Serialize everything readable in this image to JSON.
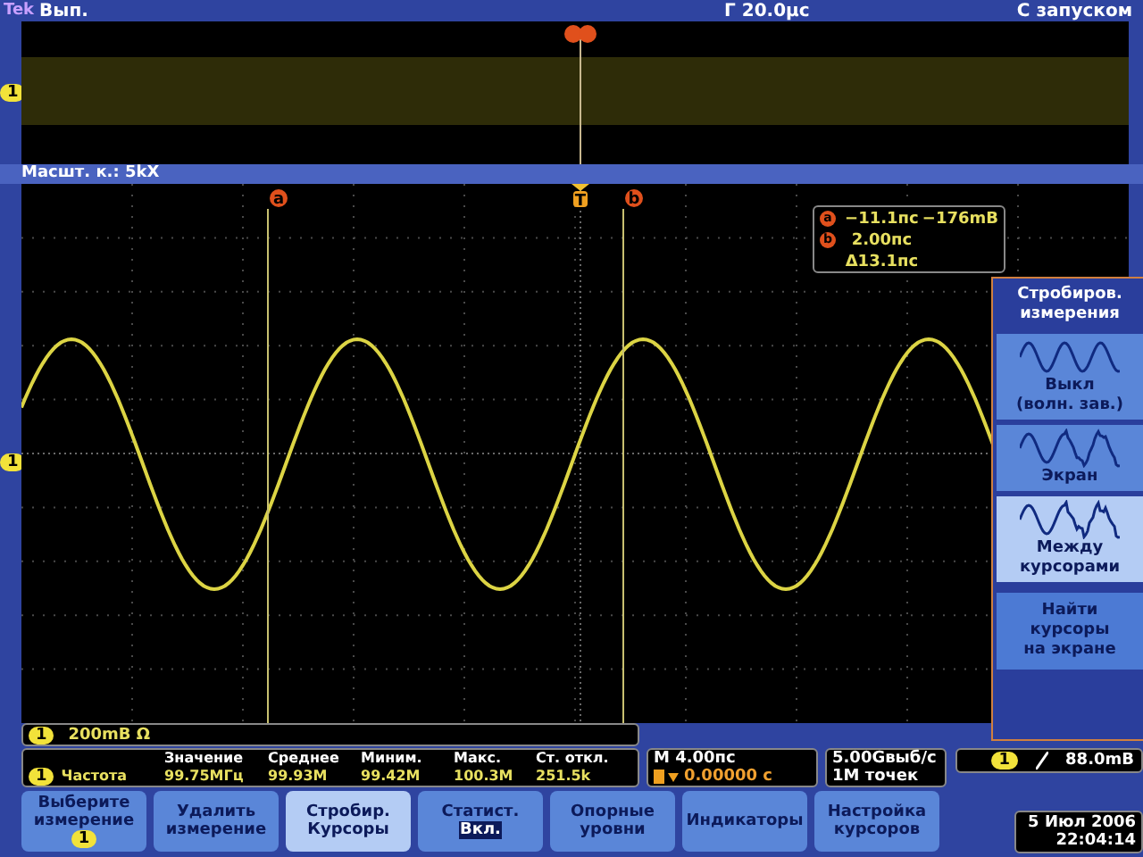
{
  "top_bar": {
    "logo": "Tek",
    "acquisition": "Вып.",
    "horizontal": "Г 20.0μс",
    "trigger_mode": "С запуском"
  },
  "overview": {
    "channel": "1"
  },
  "zoom_label": "Масшт. к.: 5kX",
  "graticule": {
    "channel": "1",
    "trigger_marker": "T",
    "cursors": [
      {
        "label": "a"
      },
      {
        "label": "b"
      }
    ]
  },
  "cursor_readout": {
    "rows": [
      {
        "marker": "a",
        "time": "−11.1пс",
        "value": "−176mВ"
      },
      {
        "marker": "b",
        "time": "2.00пс"
      }
    ],
    "delta": "Δ13.1пс"
  },
  "side_menu": {
    "title": "Стробиров.\nизмерения",
    "items": [
      {
        "kind": "option",
        "label": "Выкл\n(волн. зав.)",
        "selected": false
      },
      {
        "kind": "option",
        "label": "Экран",
        "selected": false
      },
      {
        "kind": "option",
        "label": "Между\nкурсорами",
        "selected": true
      },
      {
        "kind": "action",
        "label": "Найти\nкурсоры\nна экране"
      }
    ]
  },
  "channel_bar": {
    "channel": "1",
    "scale": "200mВ Ω"
  },
  "measurements": {
    "columns": [
      "Значение",
      "Среднее",
      "Миним.",
      "Макс.",
      "Ст. откл."
    ],
    "rows": [
      {
        "channel": "1",
        "name": "Частота",
        "values": [
          "99.75MГц",
          "99.93M",
          "99.42M",
          "100.3M",
          "251.5k"
        ]
      }
    ]
  },
  "timebase": {
    "scale": "M 4.00пс",
    "trigger_position": "0.00000 с"
  },
  "acquisition": {
    "rate": "5.00Gвыб/с",
    "length": "1M точек"
  },
  "trigger": {
    "channel": "1",
    "level": "88.0mВ"
  },
  "buttons": [
    {
      "label": "Выберите\nизмерение",
      "badge": "1",
      "selected": false
    },
    {
      "label": "Удалить\nизмерение",
      "selected": false
    },
    {
      "label": "Стробир.\nКурсоры",
      "selected": true
    },
    {
      "label": "Статист.",
      "value": "Вкл.",
      "selected": false
    },
    {
      "label": "Опорные\nуровни",
      "selected": false
    },
    {
      "label": "Индикаторы",
      "selected": false
    },
    {
      "label": "Настройка\nкурсоров",
      "selected": false
    }
  ],
  "datetime": {
    "date": "5 Июл 2006",
    "time": "22:04:14"
  }
}
